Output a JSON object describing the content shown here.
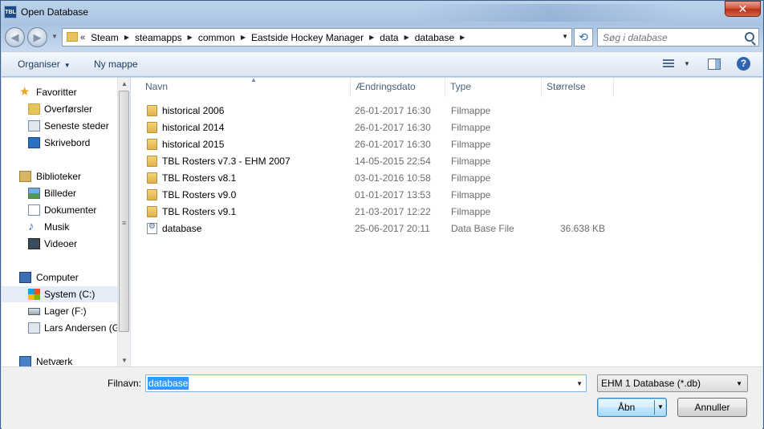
{
  "window": {
    "title": "Open Database",
    "icon_text": "TBL",
    "close_symbol": "✕"
  },
  "address": {
    "overflow": "«",
    "crumbs": [
      "Steam",
      "steamapps",
      "common",
      "Eastside Hockey Manager",
      "data",
      "database"
    ]
  },
  "search": {
    "placeholder": "Søg i database"
  },
  "toolbar": {
    "organize_label": "Organiser",
    "new_folder_label": "Ny mappe",
    "help_label": "?"
  },
  "nav": {
    "favorites": {
      "label": "Favoritter",
      "items": [
        "Overførsler",
        "Seneste steder",
        "Skrivebord"
      ]
    },
    "libraries": {
      "label": "Biblioteker",
      "items": [
        "Billeder",
        "Dokumenter",
        "Musik",
        "Videoer"
      ]
    },
    "computer": {
      "label": "Computer",
      "items": [
        "System (C:)",
        "Lager (F:)",
        "Lars Andersen (G"
      ]
    },
    "network": {
      "label": "Netværk"
    }
  },
  "columns": {
    "name": "Navn",
    "date": "Ændringsdato",
    "type": "Type",
    "size": "Størrelse"
  },
  "files": [
    {
      "name": "historical 2006",
      "date": "26-01-2017 16:30",
      "type": "Filmappe",
      "size": "",
      "icon": "folder-icon"
    },
    {
      "name": "historical 2014",
      "date": "26-01-2017 16:30",
      "type": "Filmappe",
      "size": "",
      "icon": "folder-icon"
    },
    {
      "name": "historical 2015",
      "date": "26-01-2017 16:30",
      "type": "Filmappe",
      "size": "",
      "icon": "folder-icon"
    },
    {
      "name": "TBL Rosters v7.3 - EHM 2007",
      "date": "14-05-2015 22:54",
      "type": "Filmappe",
      "size": "",
      "icon": "folder-icon"
    },
    {
      "name": "TBL Rosters v8.1",
      "date": "03-01-2016 10:58",
      "type": "Filmappe",
      "size": "",
      "icon": "folder-icon"
    },
    {
      "name": "TBL Rosters v9.0",
      "date": "01-01-2017 13:53",
      "type": "Filmappe",
      "size": "",
      "icon": "folder-icon"
    },
    {
      "name": "TBL Rosters v9.1",
      "date": "21-03-2017 12:22",
      "type": "Filmappe",
      "size": "",
      "icon": "folder-icon"
    },
    {
      "name": "database",
      "date": "25-06-2017 20:11",
      "type": "Data Base File",
      "size": "36.638 KB",
      "icon": "database-file-icon"
    }
  ],
  "footer": {
    "filename_label": "Filnavn:",
    "filename_value": "database",
    "filter_value": "EHM 1 Database (*.db)",
    "open_label": "Åbn",
    "cancel_label": "Annuller"
  },
  "colors": {
    "accent": "#3399ff",
    "folder": "#e8c25a",
    "title_bar": "#a9c4e2",
    "close_button": "#c8462e"
  }
}
